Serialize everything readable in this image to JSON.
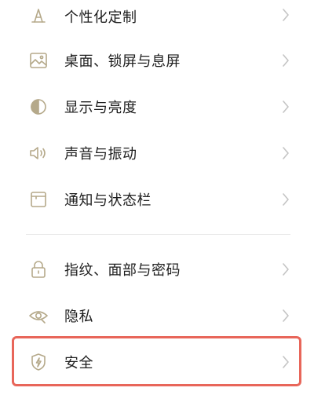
{
  "settings": {
    "group_one": [
      {
        "label": "个性化定制",
        "icon": "personalization-icon"
      },
      {
        "label": "桌面、锁屏与息屏",
        "icon": "wallpaper-icon"
      },
      {
        "label": "显示与亮度",
        "icon": "display-brightness-icon"
      },
      {
        "label": "声音与振动",
        "icon": "sound-icon"
      },
      {
        "label": "通知与状态栏",
        "icon": "notification-icon"
      }
    ],
    "group_two": [
      {
        "label": "指纹、面部与密码",
        "icon": "lock-icon"
      },
      {
        "label": "隐私",
        "icon": "privacy-eye-icon"
      },
      {
        "label": "安全",
        "icon": "security-shield-icon"
      }
    ]
  },
  "colors": {
    "icon": "#b5a98a",
    "text": "#1e1e1e",
    "chevron": "#c4c4c4",
    "highlight": "#e8665a",
    "divider": "#e8e8e8"
  }
}
